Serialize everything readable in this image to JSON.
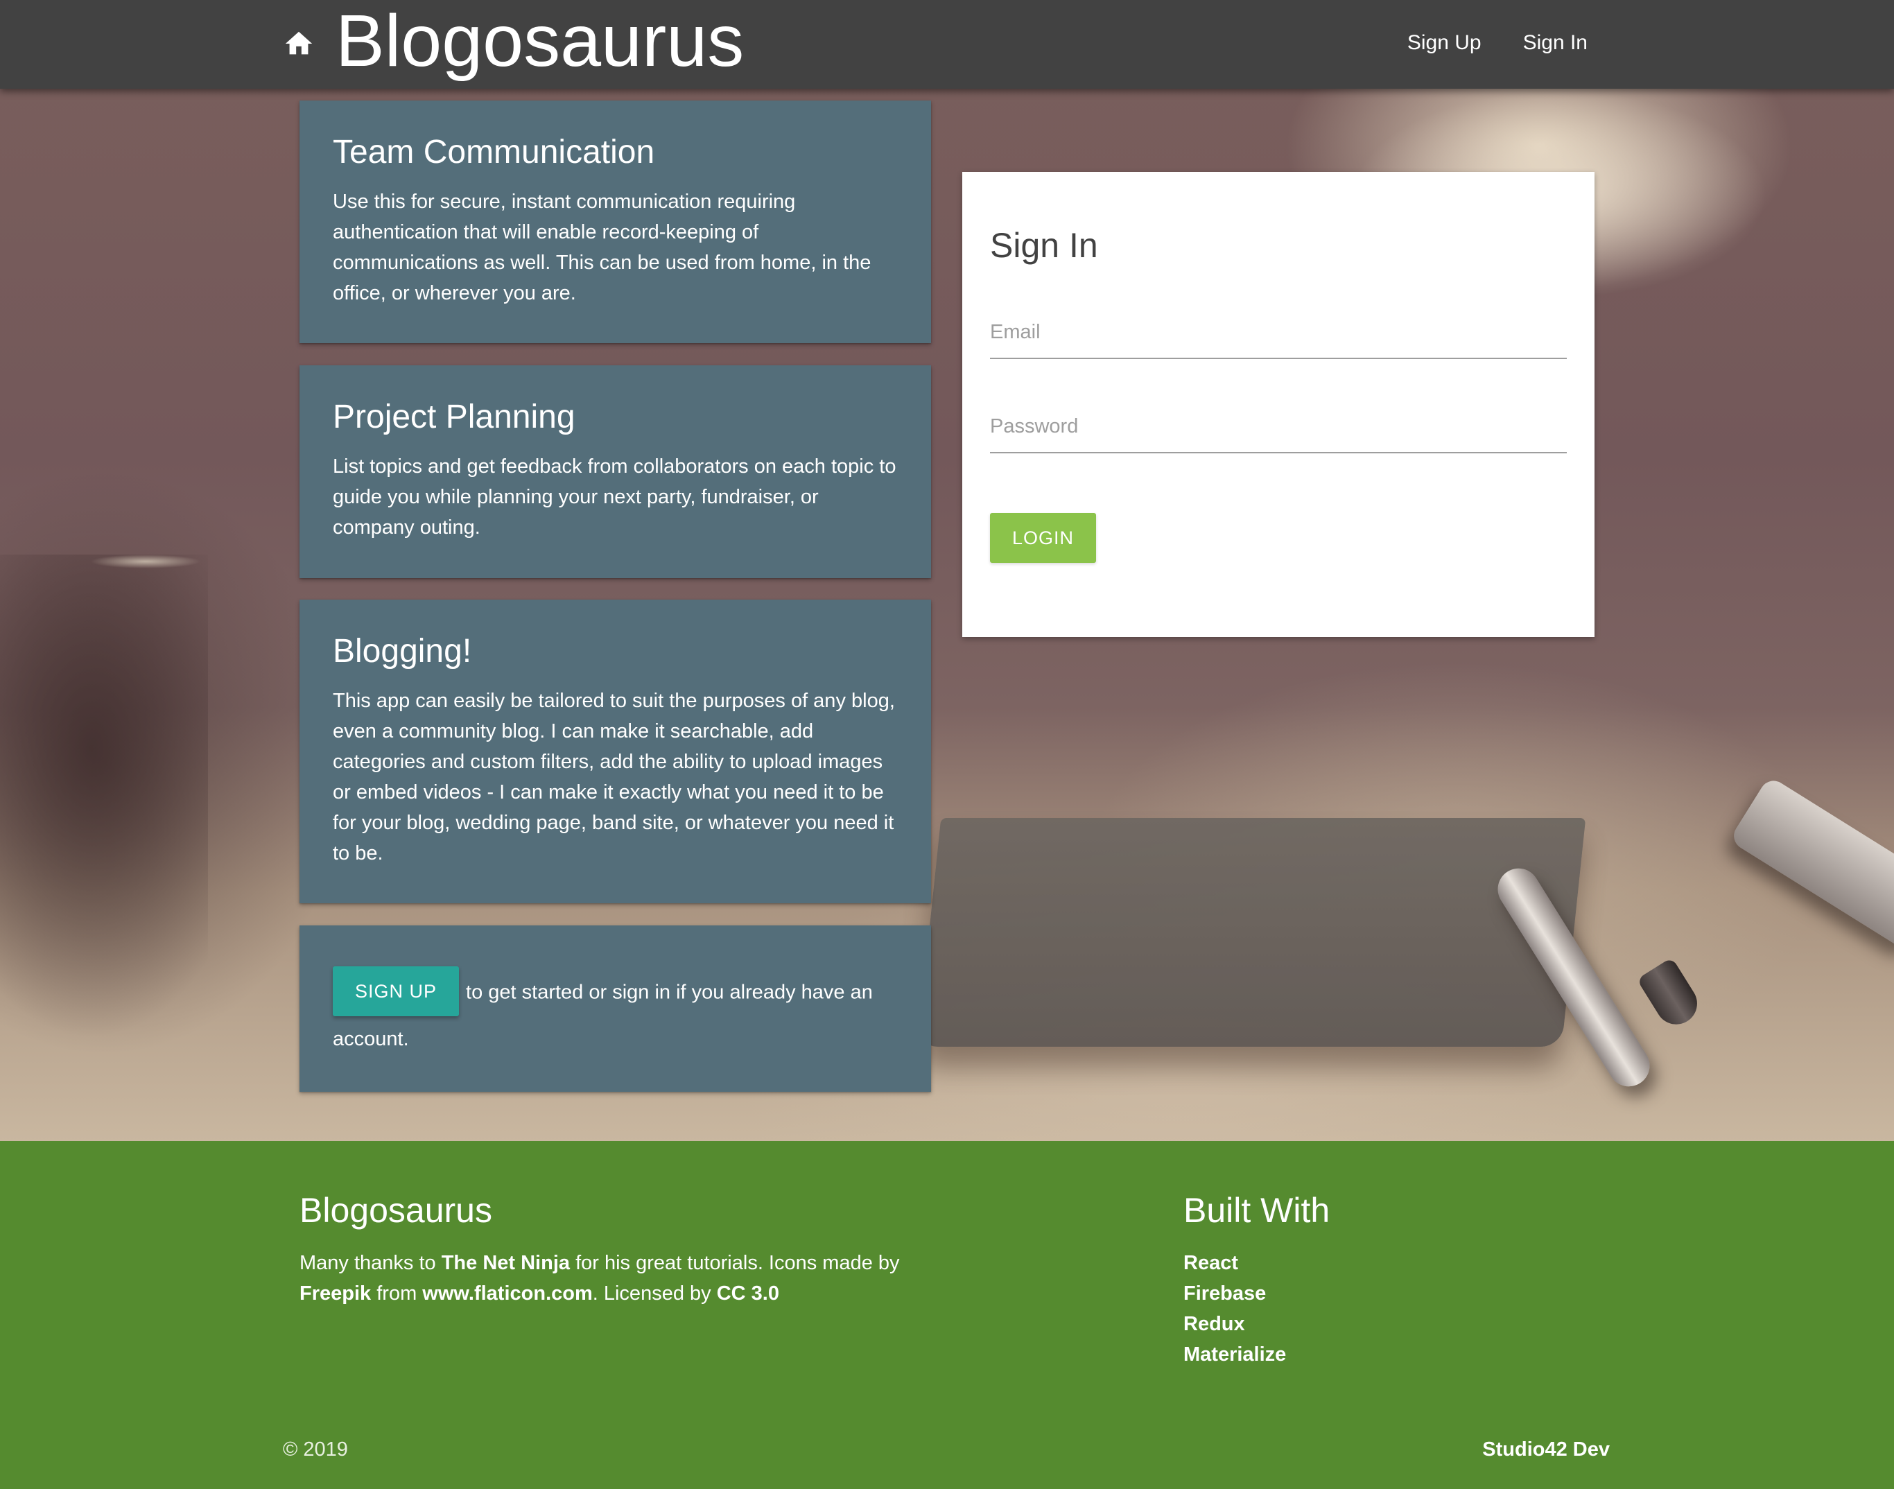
{
  "navbar": {
    "brand": "Blogosaurus",
    "links": [
      "Sign Up",
      "Sign In"
    ]
  },
  "features": [
    {
      "title": "Team Communication",
      "text": "Use this for secure, instant communication requiring authentication that will enable record-keeping of communications as well. This can be used from home, in the office, or wherever you are."
    },
    {
      "title": "Project Planning",
      "text": "List topics and get feedback from collaborators on each topic to guide you while planning your next party, fundraiser, or company outing."
    },
    {
      "title": "Blogging!",
      "text": "This app can easily be tailored to suit the purposes of any blog, even a community blog. I can make it searchable, add categories and custom filters, add the ability to upload images or embed videos - I can make it exactly what you need it to be for your blog, wedding page, band site, or whatever you need it to be."
    }
  ],
  "cta": {
    "button": "SIGN UP",
    "text": "to get started or sign in if you already have an account."
  },
  "signin": {
    "title": "Sign In",
    "email_placeholder": "Email",
    "password_placeholder": "Password",
    "login_button": "LOGIN"
  },
  "footer": {
    "about_title": "Blogosaurus",
    "about_parts": {
      "p1": "Many thanks to ",
      "b1": "The Net Ninja",
      "p2": " for his great tutorials. Icons made by ",
      "b2": "Freepik",
      "p3": " from ",
      "b3": "www.flaticon.com",
      "p4": ". Licensed by ",
      "b4": "CC 3.0"
    },
    "built_title": "Built With",
    "built_items": [
      "React",
      "Firebase",
      "Redux",
      "Materialize"
    ],
    "copyright": "© 2019",
    "credit": "Studio42 Dev"
  },
  "colors": {
    "navbar": "#424242",
    "card": "#546e7a",
    "signup_button": "#26a69a",
    "login_button": "#8bc34a",
    "footer": "#558b2f"
  }
}
